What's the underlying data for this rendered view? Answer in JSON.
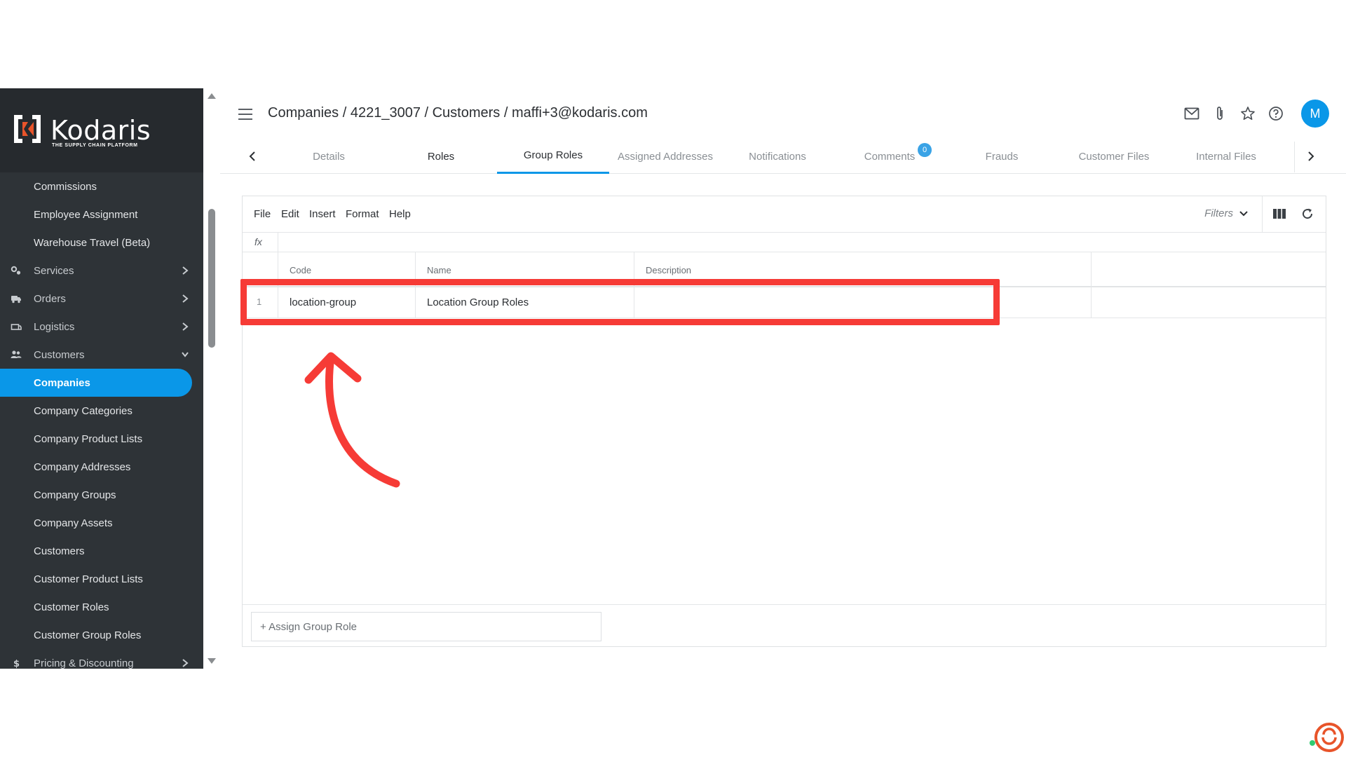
{
  "brand": {
    "name": "Kodaris",
    "tagline": "THE SUPPLY CHAIN PLATFORM",
    "accent": "#0a97e8",
    "logo_color": "#e8542a"
  },
  "sidebar": {
    "items": [
      {
        "label": "Commissions",
        "kind": "sub"
      },
      {
        "label": "Employee Assignment",
        "kind": "sub"
      },
      {
        "label": "Warehouse Travel (Beta)",
        "kind": "sub"
      },
      {
        "label": "Services",
        "kind": "section",
        "icon": "services-icon",
        "chevron": "right"
      },
      {
        "label": "Orders",
        "kind": "section",
        "icon": "truck-icon",
        "chevron": "right"
      },
      {
        "label": "Logistics",
        "kind": "section",
        "icon": "logistics-icon",
        "chevron": "right"
      },
      {
        "label": "Customers",
        "kind": "section",
        "icon": "people-icon",
        "chevron": "down"
      },
      {
        "label": "Companies",
        "kind": "sub",
        "active": true
      },
      {
        "label": "Company Categories",
        "kind": "sub"
      },
      {
        "label": "Company Product Lists",
        "kind": "sub"
      },
      {
        "label": "Company Addresses",
        "kind": "sub"
      },
      {
        "label": "Company Groups",
        "kind": "sub"
      },
      {
        "label": "Company Assets",
        "kind": "sub"
      },
      {
        "label": "Customers",
        "kind": "sub"
      },
      {
        "label": "Customer Product Lists",
        "kind": "sub"
      },
      {
        "label": "Customer Roles",
        "kind": "sub"
      },
      {
        "label": "Customer Group Roles",
        "kind": "sub"
      },
      {
        "label": "Pricing & Discounting",
        "kind": "section",
        "icon": "dollar-icon",
        "chevron": "right"
      }
    ]
  },
  "header": {
    "breadcrumb": "Companies / 4221_3007 / Customers / maffi+3@kodaris.com",
    "avatar_initial": "M",
    "icons": [
      "mail-icon",
      "paperclip-icon",
      "star-icon",
      "help-icon"
    ]
  },
  "tabs": [
    {
      "label": "Details"
    },
    {
      "label": "Roles",
      "state": "hovered"
    },
    {
      "label": "Group Roles",
      "state": "selected"
    },
    {
      "label": "Assigned Addresses"
    },
    {
      "label": "Notifications"
    },
    {
      "label": "Comments",
      "badge": "0"
    },
    {
      "label": "Frauds"
    },
    {
      "label": "Customer Files"
    },
    {
      "label": "Internal Files"
    }
  ],
  "grid": {
    "menu": [
      "File",
      "Edit",
      "Insert",
      "Format",
      "Help"
    ],
    "filters_label": "Filters",
    "formula_label": "fx",
    "columns": [
      "Code",
      "Name",
      "Description"
    ],
    "rows": [
      {
        "num": "1",
        "code": "location-group",
        "name": "Location Group Roles",
        "description": ""
      }
    ],
    "assign_button": "+ Assign Group Role"
  },
  "annotation": {
    "highlight_color": "#f63b36"
  }
}
